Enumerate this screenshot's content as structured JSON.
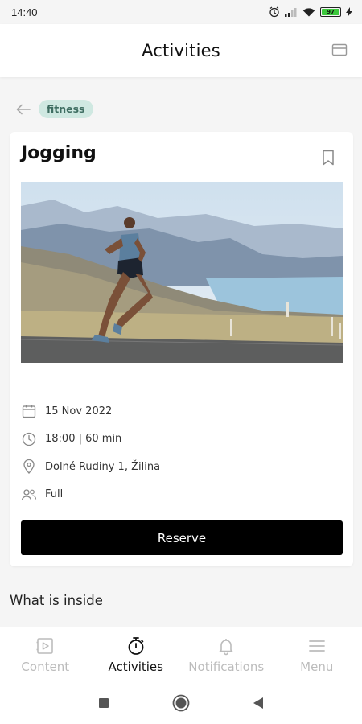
{
  "status": {
    "time": "14:40",
    "battery_level": "97"
  },
  "header": {
    "title": "Activities",
    "card_icon": "card-icon"
  },
  "breadcrumb": {
    "back_icon": "arrow-left-icon",
    "tag": "fitness"
  },
  "activity": {
    "title": "Jogging",
    "bookmark_icon": "bookmark-icon",
    "image_alt_subject": "runner on road with mountains and lake",
    "date": "15 Nov 2022",
    "time": "18:00 | 60 min",
    "location": "Dolné Rudiny 1, Žilina",
    "capacity": "Full",
    "reserve_label": "Reserve"
  },
  "section": {
    "heading": "What is inside"
  },
  "bottom_nav": {
    "items": [
      {
        "label": "Content",
        "icon": "play-square-icon",
        "active": false
      },
      {
        "label": "Activities",
        "icon": "stopwatch-icon",
        "active": true
      },
      {
        "label": "Notifications",
        "icon": "bell-icon",
        "active": false
      },
      {
        "label": "Menu",
        "icon": "menu-icon",
        "active": false
      }
    ]
  },
  "colors": {
    "tag_bg": "#cfe8e1",
    "tag_text": "#3e6d61",
    "primary_button": "#000000",
    "nav_active": "#111111",
    "nav_inactive": "#bcbcbc"
  }
}
